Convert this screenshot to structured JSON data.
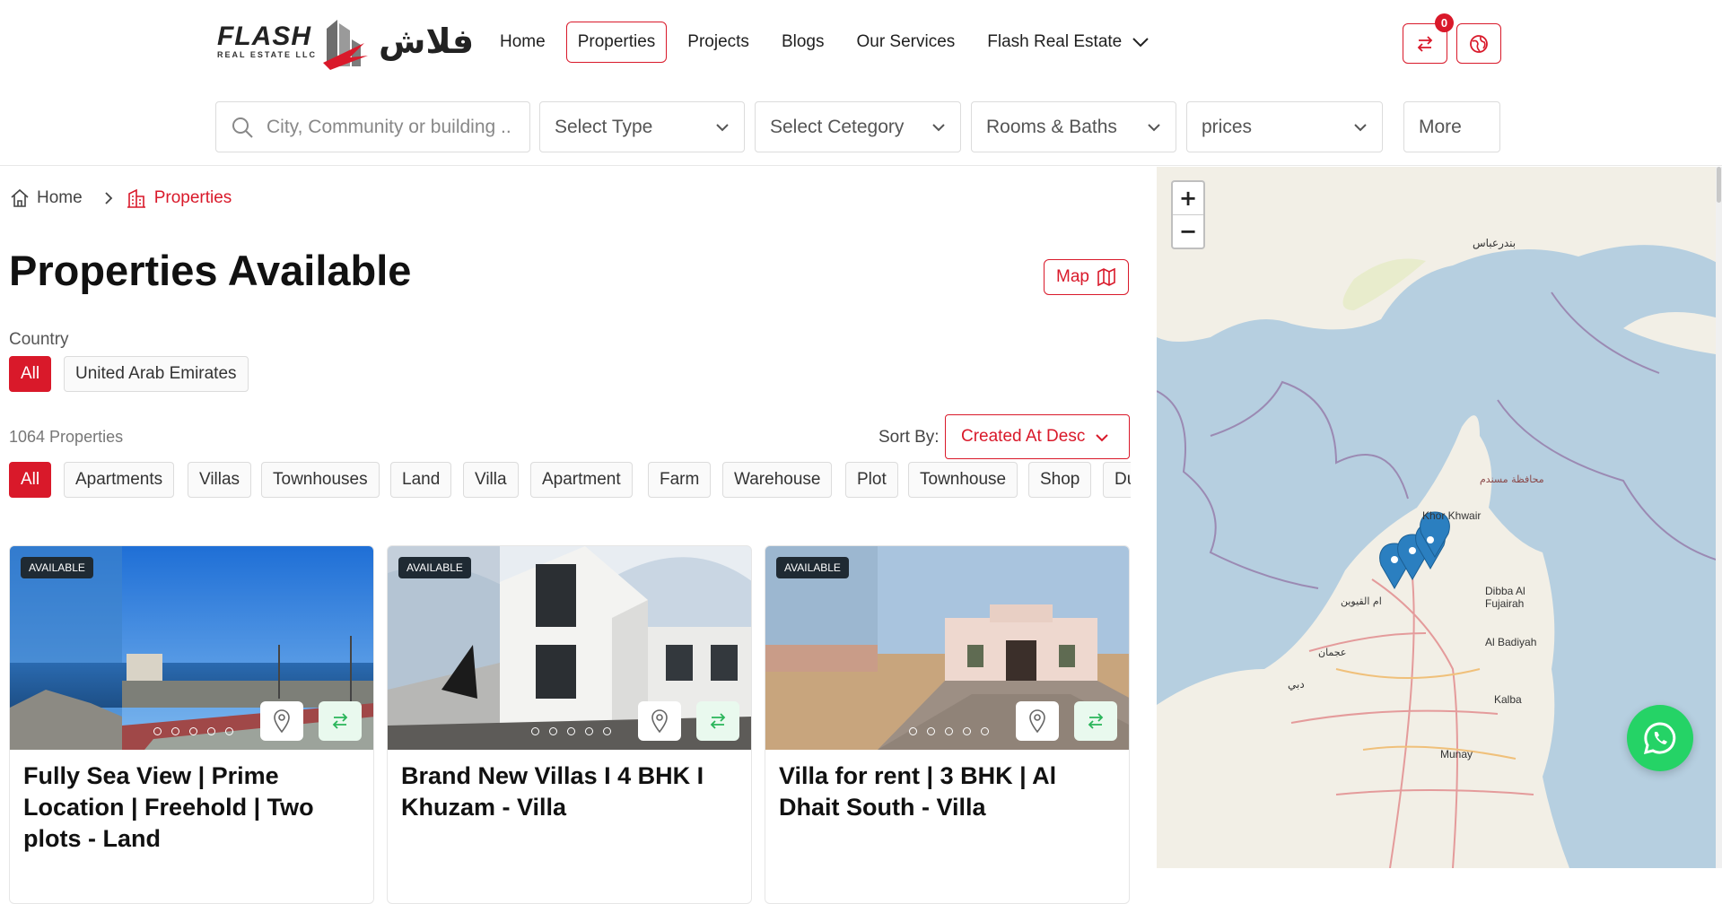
{
  "header": {
    "logo": {
      "brand": "FLASH",
      "subtitle": "REAL ESTATE LLC",
      "arabic": "فلاش"
    },
    "nav": [
      {
        "label": "Home"
      },
      {
        "label": "Properties"
      },
      {
        "label": "Projects"
      },
      {
        "label": "Blogs"
      },
      {
        "label": "Our Services"
      },
      {
        "label": "Flash Real Estate"
      }
    ],
    "compare_count": "0"
  },
  "filters": {
    "search_placeholder": "City, Community or building ..",
    "type": "Select Type",
    "category": "Select Cetegory",
    "rooms": "Rooms & Baths",
    "prices": "prices",
    "more": "More"
  },
  "breadcrumb": {
    "home": "Home",
    "current": "Properties"
  },
  "page": {
    "title": "Properties Available",
    "map_button": "Map",
    "country_label": "Country",
    "countries": [
      "All",
      "United Arab Emirates"
    ],
    "count": "1064 Properties",
    "sort_label": "Sort By:",
    "sort_value": "Created At Desc",
    "types": [
      "All",
      "Apartments",
      "Villas",
      "Townhouses",
      "Land",
      "Villa",
      "Apartment",
      "Farm",
      "Warehouse",
      "Plot",
      "Townhouse",
      "Shop",
      "Du"
    ]
  },
  "cards": [
    {
      "status": "AVAILABLE",
      "title": "Fully Sea View | Prime Location | Freehold | Two plots - Land"
    },
    {
      "status": "AVAILABLE",
      "title": "Brand New Villas I 4 BHK I Khuzam - Villa"
    },
    {
      "status": "AVAILABLE",
      "title": "Villa for rent | 3 BHK | Al Dhait South - Villa"
    }
  ],
  "map": {
    "labels": [
      "بندرعباس",
      "Khor Khwair",
      "Dibba Al Fujairah",
      "Al Badiyah",
      "Kalba",
      "Munay",
      "محافظة مسندم",
      "دبي",
      "عجمان",
      "ام القيوين"
    ]
  },
  "colors": {
    "accent": "#d9192a",
    "whatsapp": "#25d366",
    "sea": "#b6cfe0",
    "land": "#f2efe6"
  },
  "icons": [
    "home-icon",
    "building-icon",
    "chevron-right-icon",
    "search-icon",
    "chevron-down-icon",
    "compare-icon",
    "globe-icon",
    "map-icon",
    "location-pin-icon",
    "whatsapp-icon"
  ]
}
